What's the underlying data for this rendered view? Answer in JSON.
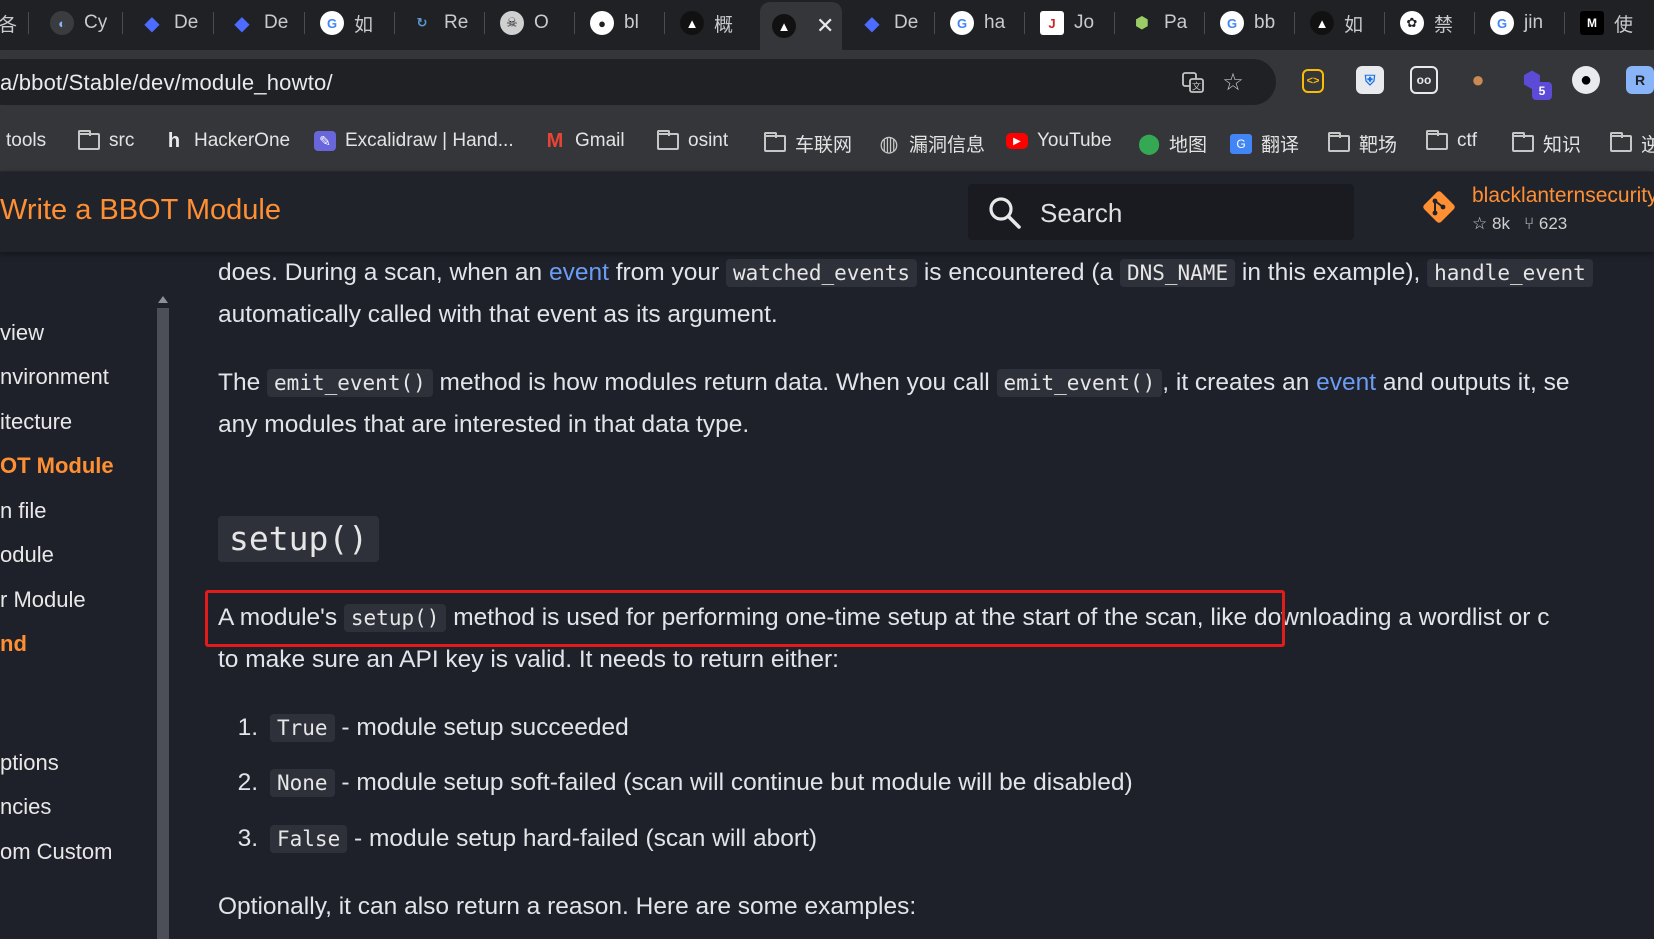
{
  "browser": {
    "tabs": [
      {
        "label": "Cy",
        "icon": "spy-icon",
        "color": "#8ab4f8"
      },
      {
        "label": "De",
        "icon": "deepseek-icon",
        "color": "#4d6bfe"
      },
      {
        "label": "De",
        "icon": "deepseek-icon",
        "color": "#4d6bfe"
      },
      {
        "label": "如",
        "icon": "google-icon",
        "color": "#ffffff"
      },
      {
        "label": "Re",
        "icon": "refresh-logo-icon",
        "color": "#5b9bd5"
      },
      {
        "label": "O",
        "icon": "skull-icon",
        "color": "#d0d0d0"
      },
      {
        "label": "bl",
        "icon": "github-icon",
        "color": "#ffffff"
      },
      {
        "label": "概",
        "icon": "penguin-icon",
        "color": "#ffffff"
      },
      {
        "label": "",
        "icon": "penguin-icon",
        "color": "#ffffff",
        "active": true
      },
      {
        "label": "De",
        "icon": "deepseek-icon",
        "color": "#4d6bfe"
      },
      {
        "label": "ha",
        "icon": "google-icon",
        "color": "#ffffff"
      },
      {
        "label": "Jo",
        "icon": "doc-icon",
        "color": "#ffffff"
      },
      {
        "label": "Pa",
        "icon": "cube-icon",
        "color": "#9ccc65"
      },
      {
        "label": "bb",
        "icon": "google-icon",
        "color": "#ffffff"
      },
      {
        "label": "如",
        "icon": "penguin-icon",
        "color": "#ffffff"
      },
      {
        "label": "禁",
        "icon": "openai-icon",
        "color": "#ffffff"
      },
      {
        "label": "jin",
        "icon": "google-icon",
        "color": "#ffffff"
      },
      {
        "label": "使",
        "icon": "medium-icon",
        "color": "#ffffff"
      }
    ],
    "address": {
      "url": "a/bbot/Stable/dev/module_howto/"
    },
    "extensions_badge": "5",
    "bookmarks": [
      {
        "label": "tools",
        "icon": "folder-icon"
      },
      {
        "label": "src",
        "icon": "folder-icon"
      },
      {
        "label": "HackerOne",
        "icon": "hackerone-icon"
      },
      {
        "label": "Excalidraw | Hand...",
        "icon": "excalidraw-icon"
      },
      {
        "label": "Gmail",
        "icon": "gmail-icon"
      },
      {
        "label": "osint",
        "icon": "folder-icon"
      },
      {
        "label": "车联网",
        "icon": "folder-icon"
      },
      {
        "label": "漏洞信息",
        "icon": "globe-icon"
      },
      {
        "label": "YouTube",
        "icon": "youtube-icon"
      },
      {
        "label": "地图",
        "icon": "maps-icon"
      },
      {
        "label": "翻译",
        "icon": "translate-icon"
      },
      {
        "label": "靶场",
        "icon": "folder-icon"
      },
      {
        "label": "ctf",
        "icon": "folder-icon"
      },
      {
        "label": "知识",
        "icon": "folder-icon"
      },
      {
        "label": "逆",
        "icon": "folder-icon"
      }
    ]
  },
  "site": {
    "title": "Write a BBOT Module",
    "search_placeholder": "Search",
    "repo": {
      "name": "blacklanternsecurity",
      "stars": "8k",
      "forks": "623"
    }
  },
  "nav": {
    "items": [
      {
        "label": "view"
      },
      {
        "label": "nvironment"
      },
      {
        "label": "itecture"
      },
      {
        "label": "OT Module",
        "active": true
      },
      {
        "label": "n file"
      },
      {
        "label": "odule"
      },
      {
        "label": "r Module"
      },
      {
        "label": "nd",
        "active": true
      },
      {
        "label": "ptions"
      },
      {
        "label": "ncies"
      },
      {
        "label": "om Custom"
      }
    ]
  },
  "content": {
    "p1_a": "does. During a scan, when an ",
    "p1_link": "event",
    "p1_b": " from your ",
    "p1_code1": "watched_events",
    "p1_c": " is encountered (a ",
    "p1_code2": "DNS_NAME",
    "p1_d": " in this example), ",
    "p1_code3": "handle_event",
    "p1_line2": "automatically called with that event as its argument.",
    "p2_a": "The ",
    "p2_code1": "emit_event()",
    "p2_b": " method is how modules return data. When you call ",
    "p2_code2": "emit_event()",
    "p2_c": ", it creates an ",
    "p2_link": "event",
    "p2_d": " and outputs it, se",
    "p2_line2": "any modules that are interested in that data type.",
    "heading": "setup()",
    "p3_a": "A module's ",
    "p3_code": "setup()",
    "p3_b": " method is used for performing one-time setup at the start of the scan",
    "p3_c": ", like downloading a wordlist or c",
    "p3_line2": "to make sure an API key is valid. It needs to return either:",
    "list": [
      {
        "num": "1.",
        "code": "True",
        "text": " - module setup succeeded"
      },
      {
        "num": "2.",
        "code": "None",
        "text": " - module setup soft-failed (scan will continue but module will be disabled)"
      },
      {
        "num": "3.",
        "code": "False",
        "text": " - module setup hard-failed (scan will abort)"
      }
    ],
    "p4": "Optionally, it can also return a reason. Here are some examples:"
  },
  "colors": {
    "accent": "#ff8f33",
    "link": "#6b9cf4",
    "highlight": "#e21b1b"
  }
}
